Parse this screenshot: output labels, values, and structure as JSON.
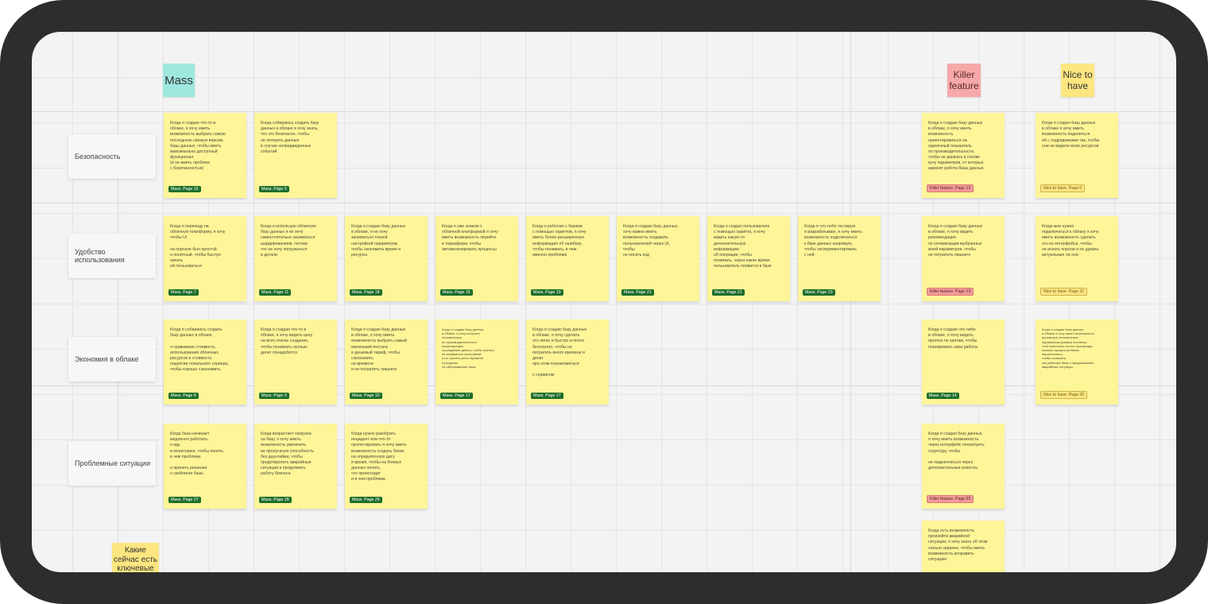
{
  "headers": {
    "mass": "Mass",
    "killer": "Killer\nfeature",
    "nice": "Nice to\nhave"
  },
  "rows": [
    "Безопасность",
    "Удобство использования",
    "Экономия в облаке",
    "Проблемные ситуации"
  ],
  "bottom_sticky": "Какие\nсейчас есть\nключевые",
  "notes": [
    {
      "text": "Когда я создаю что-то в\nоблаке, я хочу иметь\nвозможность выбрать самую\nпоследнюю свежую версию\nбазы данных, чтобы иметь\nмаксимально доступный\nфункционал\n(и не иметь проблем\nс безопасностью)",
      "tag": "Mass. Page 15",
      "kind": "mass"
    },
    {
      "text": "Когда собираюсь создать базу\nданных в облаке я хочу знать,\nчто это безопасно, чтобы\nне потерять данные\nв случае непредвиденных\nсобытий",
      "tag": "Mass. Page 5",
      "kind": "mass"
    },
    {
      "text": "Когда я создаю базу данных\nв облаке, я хочу иметь\nвозможность\nориентироваться на\nодиночный показатель\nпо производительности,\nчтобы не держать в голове\nкучу параметров, от которых\nзависит работа базы данных",
      "tag": "Killer feature. Page 12",
      "kind": "killer"
    },
    {
      "text": "Когда я создал базу данных\nв облаке я хочу иметь\nвозможность поделиться\nей с подрядчиками так, чтобы\nони не видели моих ресурсов",
      "tag": "Nice to have. Page 6",
      "kind": "nice"
    },
    {
      "text": "Когда я переходу на\nоблачную платформу, я хочу\nчтобы UI\n\nна портале был простой\nи понятный, чтобы быстро\nначать\nей пользоваться",
      "tag": "Mass. Page 7",
      "kind": "mass"
    },
    {
      "text": "Когда я использую облачную\nбазу данных я не хочу\nсамостоятельно заниматься\nшардированием, потому\nчто не хочу погружаться\nв детали",
      "tag": "Mass. Page 11",
      "kind": "mass"
    },
    {
      "text": "Когда я создаю базу данных\nв облаке, я не хочу\nзаниматься тонкой\nнастройкой параметров,\nчтобы экономить время и\nресурсы",
      "tag": "Mass. Page 18",
      "kind": "mass"
    },
    {
      "text": "Когда я уже знаком с\nоблачной платформой я хочу\nиметь возможность перейти\nв терраформ, чтобы\nавтоматизировать процессы",
      "tag": "Mass. Page 15",
      "kind": "mass"
    },
    {
      "text": "Когда я работаю с базами\nс помощью скриптов, я хочу\nиметь более расширенную\nинформацию об ошибках,\nчтобы понимать, в чем\nименно проблема",
      "tag": "Mass. Page 19",
      "kind": "mass"
    },
    {
      "text": "Когда я создаю базу данных,\nхочу важно иметь\nвозможность создавать\nпользователей через UI,\nчтобы\nне писать код",
      "tag": "Mass. Page 21",
      "kind": "mass"
    },
    {
      "text": "Когда я создал пользователя\nс помощью скрипта, я хочу\nвидеть какую-то\nдополнительную\nинформацию\nоб операции, чтобы\nпонимать, через какое время\nпользователь появится в базе",
      "tag": "Mass. Page 21",
      "kind": "mass"
    },
    {
      "text": "Когда я что-либо тестирую\nи разрабатываю, я хочу иметь\nвозможность подключаться\nк базе данных напрямую,\nчтобы экспериментировать\nс ней",
      "tag": "Mass. Page 23",
      "kind": "mass"
    },
    {
      "text": "Когда я создаю базу данных\nв облаке, я хочу видеть\nрекомендации\nпо оптимизации выбранных\nмной параметров, чтобы\nне потратить лишнего",
      "tag": "Killer feature. Page 13",
      "kind": "killer"
    },
    {
      "text": "Когда мне нужно\nподключаться к облаку я хочу\nиметь возможность сделать\nэто из интерфейса, чтобы\nне искать пороли и не думать\nактуальные ли они",
      "tag": "Nice to have. Page 22",
      "kind": "nice"
    },
    {
      "text": "Когда я собираюсь создать\nбазу данных в облаке,\n\nя сравниваю стоимость\nиспользования облачных\nресурсов и стоимость\nподнятия локального сервера,\nчтобы хорошо сэкономить",
      "tag": "Mass. Page 8",
      "kind": "mass"
    },
    {
      "text": "Когда я создаю что-то в\nоблаке, я хочу видеть цену\nна всех этапах создания,\nчтобы понимать сколько\nденег понадобится",
      "tag": "Mass. Page 9",
      "kind": "mass"
    },
    {
      "text": "Когда я создаю базу данных\nв облаке, я хочу иметь\nвозможность выбрать самый\nмаленький инстанс\nи дешевый тариф, чтобы\nсэкономить\nна времени\nи не потратить лишнего",
      "tag": "Mass. Page 10",
      "kind": "mass"
    },
    {
      "text": "Когда я создаю базу данных\nв облаке, я хочу получить\nоптимальную\nпо производительности\nконфигурацию\nза разумные деньги, чтобы тратить\nне заниматься настройкой\nи не тратить много времени\nв ресурсах\nна обслуживание базы",
      "tag": "Mass. Page 17",
      "kind": "mass",
      "tiny": true
    },
    {
      "text": "Когда я создаю базу данных\nв облаке, я хочу сделать\nэто легко и быстро и почти\nбесплатно, чтобы не\nпотратить много времени и\nденег\nпри этом познакомиться\n\nс сервисом",
      "tag": "Mass. Page 17",
      "kind": "mass"
    },
    {
      "text": "Когда я создаю что-либо\nв облаке, я хочу видеть\nпрогноз по заотам, чтобы\nпланировать свои работы",
      "tag": "Mass. Page 14",
      "kind": "mass"
    },
    {
      "text": "Когда я создаю базу данных\nв облаке я хочу иметь возможность\nпросмотра оптимальных\nпараметров (размер инстанса,\nчтоб тратилась на них производят,\nсколько процессов бекап\nпараллельно),\nчтобы понимать,\nкак работает база и предсказывать\nаварийные ситуации",
      "tag": "Nice to have. Page 26",
      "kind": "nice",
      "tiny": true
    },
    {
      "text": "Когда база начинает\nмедленно работать,\nя иду\nв мониторинг, чтобы понять\nв чем проблема\n\nи принять решение\nо скейлинге базы",
      "tag": "Mass. Page 27",
      "kind": "mass"
    },
    {
      "text": "Когда возрастает нагрузка\nна базу, я хочу иметь\nвозможность увеличить\nее пропускную способность\nбез даунтайма, чтобы\nпредотвратить аварийные\nситуации и продолжить\nработу бизнеса",
      "tag": "Mass. Page 28",
      "kind": "mass"
    },
    {
      "text": "Когда нужно разобрать\nинцидент или что-то\nпротестировать я хочу иметь\nвозможность создать бекап\nна определенную дату\nи время, чтобы на боевых\nданных понять,\nчто происходит\nи в чем проблема",
      "tag": "Mass. Page 29",
      "kind": "mass"
    },
    {
      "text": "Когда я создал базу данных,\nя хочу иметь возможность\nчерез интерфейс посмотреть\nструктуру, чтобы\n\nне подключаться через\nдополнительные клиенты",
      "tag": "Killer feature. Page 20",
      "kind": "killer"
    },
    {
      "text": "Когда есть возможность\nпроизойти аварийной\nситуации, я хочу знать об этом\nсильно заранее, чтобы иметь\nвозможность исправить\nситуацию",
      "tag": "",
      "kind": "killer"
    }
  ]
}
